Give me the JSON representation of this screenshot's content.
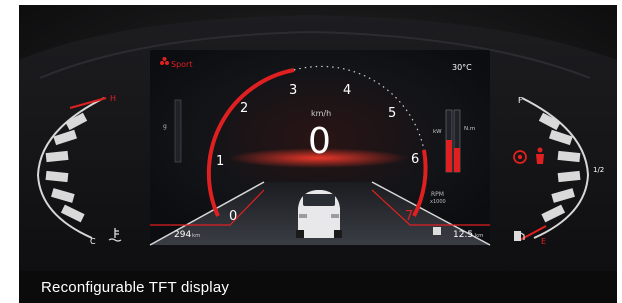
{
  "caption": "Reconfigurable TFT display",
  "screen": {
    "drive_mode": "Sport",
    "outside_temp": "30°C",
    "speed_unit": "km/h",
    "speed_value": "0",
    "rpm_ticks": [
      "0",
      "1",
      "2",
      "3",
      "4",
      "5",
      "6",
      "7"
    ],
    "rpm_label_line1": "RPM",
    "rpm_label_line2": "x1000",
    "range_left": "294",
    "range_left_unit": "km",
    "range_right": "12.5",
    "range_right_unit": "km",
    "power_label": "kW",
    "torque_label": "N.m",
    "left_bar_label": "g"
  },
  "temp_gauge": {
    "high_label": "H",
    "low_label": "C"
  },
  "fuel_gauge": {
    "full_label": "F",
    "half_label": "1/2",
    "empty_label": "E"
  },
  "colors": {
    "accent_red": "#e02020",
    "screen_bg": "#0f1216",
    "caption_bg": "#0b0b0b"
  }
}
